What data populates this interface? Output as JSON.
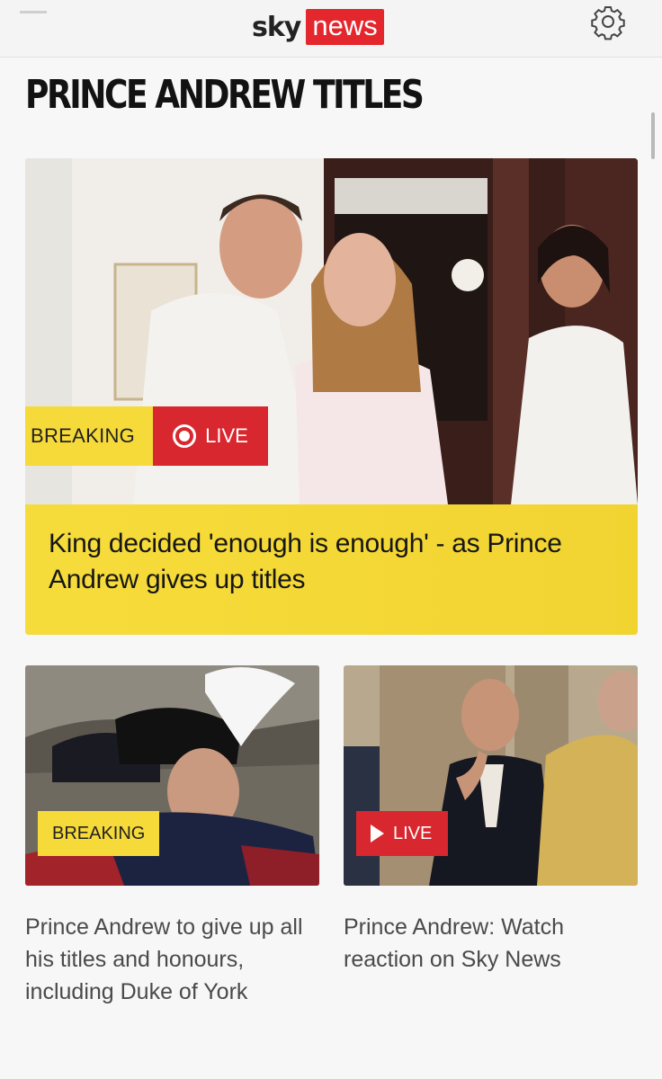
{
  "header": {
    "logo_sky": "sky",
    "logo_news": "news",
    "brand_color": "#e4262d"
  },
  "page": {
    "title": "PRINCE ANDREW TITLES"
  },
  "hero": {
    "breaking_label": "BREAKING",
    "live_label": "LIVE",
    "headline": "King decided 'enough is enough' - as Prince Andrew gives up titles",
    "caption_color": "#f6dc3b"
  },
  "cards": [
    {
      "badge": "BREAKING",
      "title": "Prince Andrew to give up all his titles and honours, including Duke of York"
    },
    {
      "badge": "LIVE",
      "title": "Prince Andrew: Watch reaction on Sky News"
    }
  ],
  "colors": {
    "breaking_yellow": "#f6da3a",
    "live_red": "#d8272e"
  }
}
